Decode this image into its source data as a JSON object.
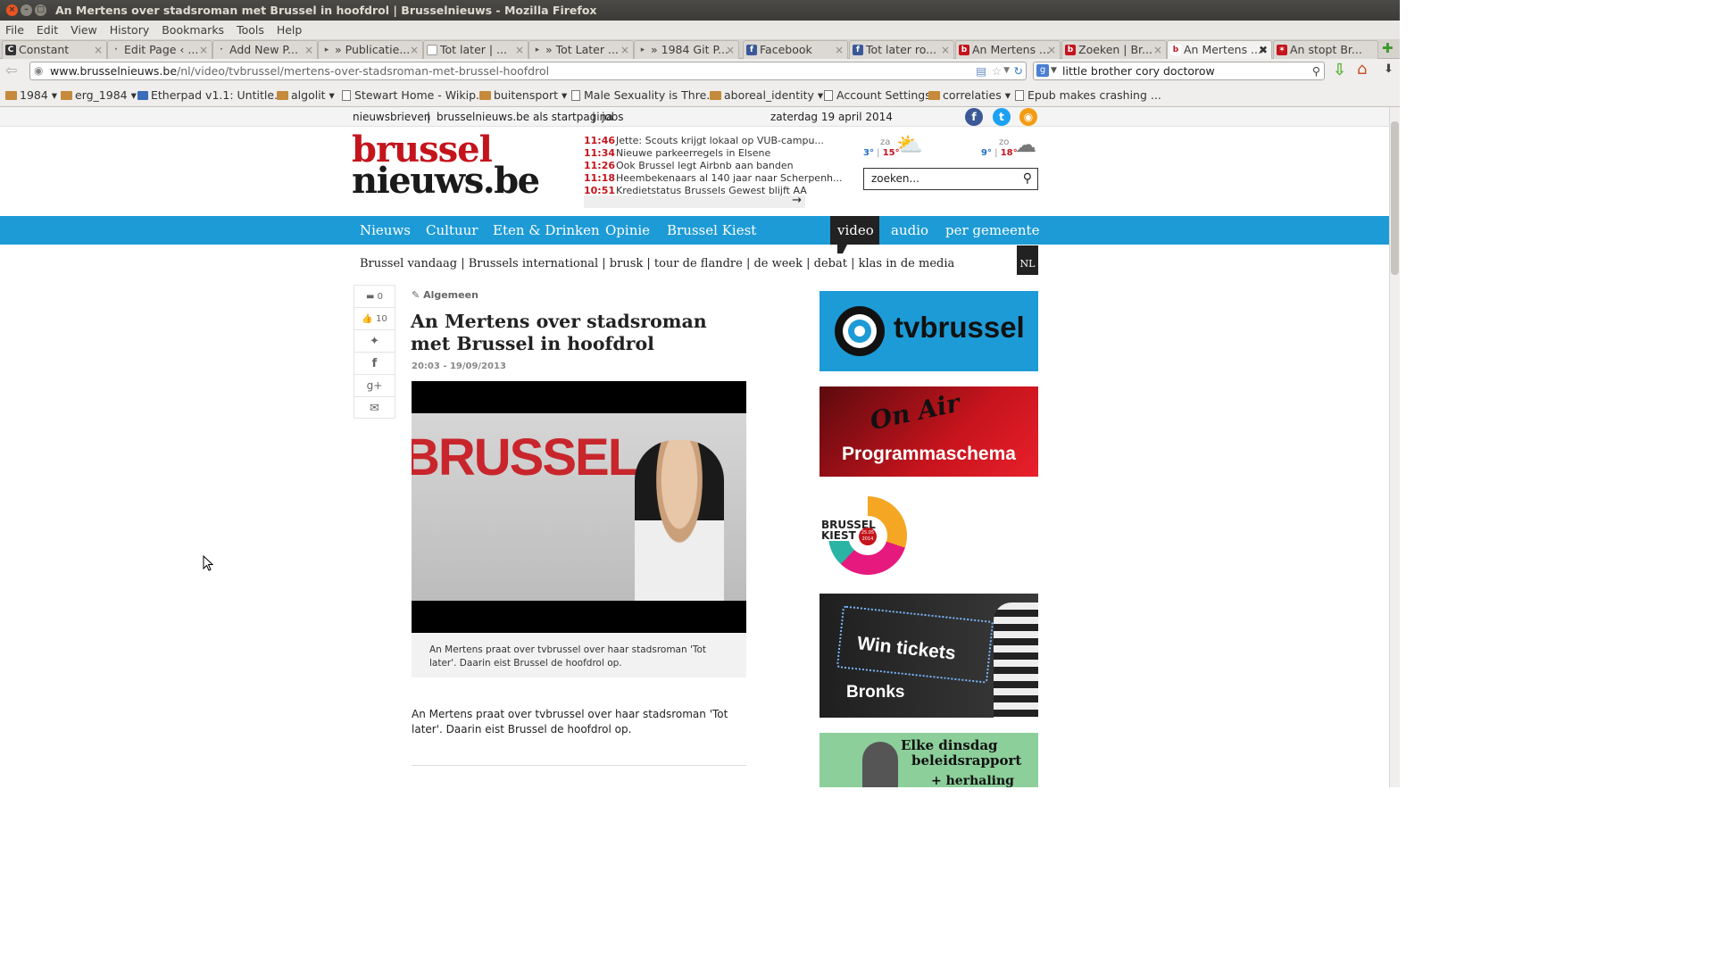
{
  "window": {
    "title": "An Mertens over stadsroman met Brussel in hoofdrol | Brusselnieuws - Mozilla Firefox"
  },
  "menu": [
    "File",
    "Edit",
    "View",
    "History",
    "Bookmarks",
    "Tools",
    "Help"
  ],
  "tabs": [
    {
      "label": "Constant",
      "active": false
    },
    {
      "label": "Edit Page ‹ ...",
      "active": false
    },
    {
      "label": "Add New P...",
      "active": false
    },
    {
      "label": "» Publicatie...",
      "active": false
    },
    {
      "label": "Tot later | ...",
      "active": false
    },
    {
      "label": "» Tot Later ...",
      "active": false
    },
    {
      "label": "» 1984 Git P...",
      "active": false
    },
    {
      "label": "Facebook",
      "active": false
    },
    {
      "label": "Tot later ro...",
      "active": false
    },
    {
      "label": "An Mertens ...",
      "active": false
    },
    {
      "label": "Zoeken | Br...",
      "active": false
    },
    {
      "label": "An Mertens ...",
      "active": true
    },
    {
      "label": "An stopt Br...",
      "active": false
    }
  ],
  "navbar": {
    "url_domain": "www.brusselnieuws.be",
    "url_path": "/nl/video/tvbrussel/mertens-over-stadsroman-met-brussel-hoofdrol",
    "search_value": "little brother cory doctorow"
  },
  "bookmarks": [
    {
      "label": "1984",
      "type": "folder"
    },
    {
      "label": "erg_1984",
      "type": "folder"
    },
    {
      "label": "Etherpad v1.1: Untitle...",
      "type": "page"
    },
    {
      "label": "algolit",
      "type": "folder"
    },
    {
      "label": "Stewart Home - Wikip...",
      "type": "page"
    },
    {
      "label": "buitensport",
      "type": "folder"
    },
    {
      "label": "Male Sexuality is Thre...",
      "type": "page"
    },
    {
      "label": "aboreal_identity",
      "type": "folder"
    },
    {
      "label": "Account Settings",
      "type": "page"
    },
    {
      "label": "correlaties",
      "type": "folder"
    },
    {
      "label": "Epub makes crashing ...",
      "type": "page"
    }
  ],
  "site": {
    "toplinks": [
      "nieuwsbrieven",
      "|",
      "brusselnieuws.be als startpagina",
      "|",
      "jobs"
    ],
    "date": "zaterdag 19 april 2014",
    "logo_line1": "brussel",
    "logo_line2": "nieuws.be",
    "ticker": [
      {
        "time": "11:46",
        "headline": "Jette: Scouts krijgt lokaal op VUB-campu..."
      },
      {
        "time": "11:34",
        "headline": "Nieuwe parkeerregels in Elsene"
      },
      {
        "time": "11:26",
        "headline": "Ook Brussel legt Airbnb aan banden"
      },
      {
        "time": "11:18",
        "headline": "Heembekenaars al 140 jaar naar Scherpenh..."
      },
      {
        "time": "10:51",
        "headline": "Kredietstatus Brussels Gewest blijft AA"
      }
    ],
    "weather": [
      {
        "day": "za",
        "min": "3°",
        "max": "15°"
      },
      {
        "day": "zo",
        "min": "9°",
        "max": "18°"
      }
    ],
    "search_placeholder": "zoeken...",
    "nav": [
      "Nieuws",
      "Cultuur",
      "Eten & Drinken",
      "Opinie",
      "Brussel Kiest",
      "video",
      "audio",
      "per gemeente"
    ],
    "subnav": "Brussel vandaag | Brussels international | brusk | tour de flandre | de week | debat | klas in de media",
    "lang": "NL"
  },
  "article": {
    "comments": "0",
    "likes": "10",
    "category": "Algemeen",
    "title": "An Mertens over stadsroman met Brussel in hoofdrol",
    "datetime": "20:03 - 19/09/2013",
    "video_wall_text": "BRUSSEL",
    "caption": "An Mertens praat over tvbrussel over haar stadsroman 'Tot later'. Daarin eist Brussel de hoofdrol op.",
    "body": "An Mertens praat over tvbrussel over haar stadsroman 'Tot later'. Daarin eist Brussel de hoofdrol op."
  },
  "sidebar": {
    "ad1": "tvbrussel",
    "ad2_top": "On Air",
    "ad2_bottom": "Programmaschema",
    "ad3_line1": "BRUSSEL",
    "ad3_line2": "KIEST",
    "ad3_date": "25.05 2014",
    "ad4_top": "Win tickets",
    "ad4_bottom": "Bronks",
    "ad5_line1": "Elke dinsdag",
    "ad5_line2": "beleidsrapport",
    "ad5_line3": "+ herhaling"
  },
  "colors": {
    "brand_red": "#c4141c",
    "nav_blue": "#1d9bd6",
    "dark": "#222222"
  }
}
